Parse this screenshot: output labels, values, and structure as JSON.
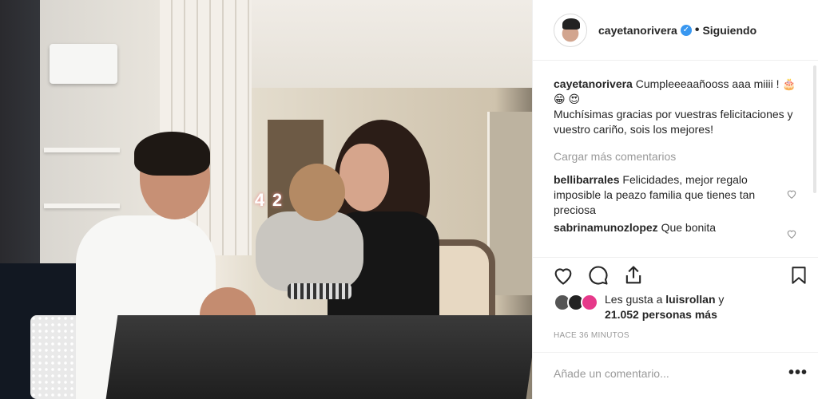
{
  "header": {
    "username": "cayetanorivera",
    "verified_icon": "verified-badge-icon",
    "separator": "•",
    "follow_status": "Siguiendo"
  },
  "caption": {
    "username": "cayetanorivera",
    "line1": "Cumpleeeaañooss aaa miiii ! 🎂 😁 😍",
    "line2": "Muchísimas gracias por vuestras felicitaciones y vuestro cariño, sois los mejores!"
  },
  "load_more": "Cargar más comentarios",
  "comments": [
    {
      "username": "bellibarrales",
      "text": "Felicidades, mejor regalo imposible la peazo familia que tienes tan preciosa"
    },
    {
      "username": "sabrinamunozlopez",
      "text": "Que bonita"
    }
  ],
  "photo": {
    "candle_digits": [
      "4",
      "2"
    ]
  },
  "likes": {
    "prefix": "Les gusta a",
    "user": "luisrollan",
    "connector": "y",
    "count_text": "21.052 personas más"
  },
  "timestamp": "HACE 36 MINUTOS",
  "add_comment_placeholder": "Añade un comentario...",
  "more_options": "•••",
  "colors": {
    "accent": "#3897f0",
    "text": "#262626",
    "muted": "#999999",
    "border": "#efefef"
  }
}
